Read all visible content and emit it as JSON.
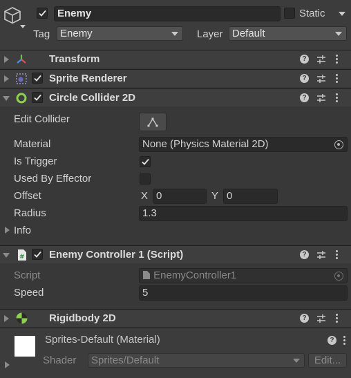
{
  "gameobject": {
    "name": "Enemy",
    "active": true,
    "static_label": "Static",
    "static_checked": false,
    "tag_label": "Tag",
    "tag_value": "Enemy",
    "layer_label": "Layer",
    "layer_value": "Default"
  },
  "components": {
    "transform": {
      "title": "Transform"
    },
    "sprite_renderer": {
      "title": "Sprite Renderer",
      "enabled": true
    },
    "circle_collider": {
      "title": "Circle Collider 2D",
      "enabled": true,
      "edit_collider_label": "Edit Collider",
      "material_label": "Material",
      "material_value": "None (Physics Material 2D)",
      "is_trigger_label": "Is Trigger",
      "is_trigger": true,
      "used_by_effector_label": "Used By Effector",
      "used_by_effector": false,
      "offset_label": "Offset",
      "offset_x_label": "X",
      "offset_x": "0",
      "offset_y_label": "Y",
      "offset_y": "0",
      "radius_label": "Radius",
      "radius": "1.3",
      "info_label": "Info"
    },
    "enemy_controller": {
      "title": "Enemy Controller 1 (Script)",
      "enabled": true,
      "script_label": "Script",
      "script_value": "EnemyController1",
      "speed_label": "Speed",
      "speed": "5"
    },
    "rigidbody": {
      "title": "Rigidbody 2D"
    },
    "material": {
      "title": "Sprites-Default (Material)",
      "shader_label": "Shader",
      "shader_value": "Sprites/Default",
      "edit_label": "Edit..."
    }
  },
  "colors": {
    "background": "#383838",
    "header": "#3e3e3e",
    "field": "#2a2a2a",
    "text": "#d2d2d2",
    "transform_icon_red": "#e05050",
    "transform_icon_green": "#6cc04a",
    "transform_icon_blue": "#4a8fe0",
    "collider_green": "#8fd14f"
  },
  "icons": {
    "gameobject": "cube-icon",
    "transform": "transform-axes-icon",
    "sprite_renderer": "sprite-renderer-icon",
    "circle_collider": "circle-collider-icon",
    "script": "script-file-icon",
    "rigidbody": "rigidbody-icon",
    "help": "help-icon",
    "presets": "presets-icon",
    "menu": "kebab-menu-icon"
  }
}
